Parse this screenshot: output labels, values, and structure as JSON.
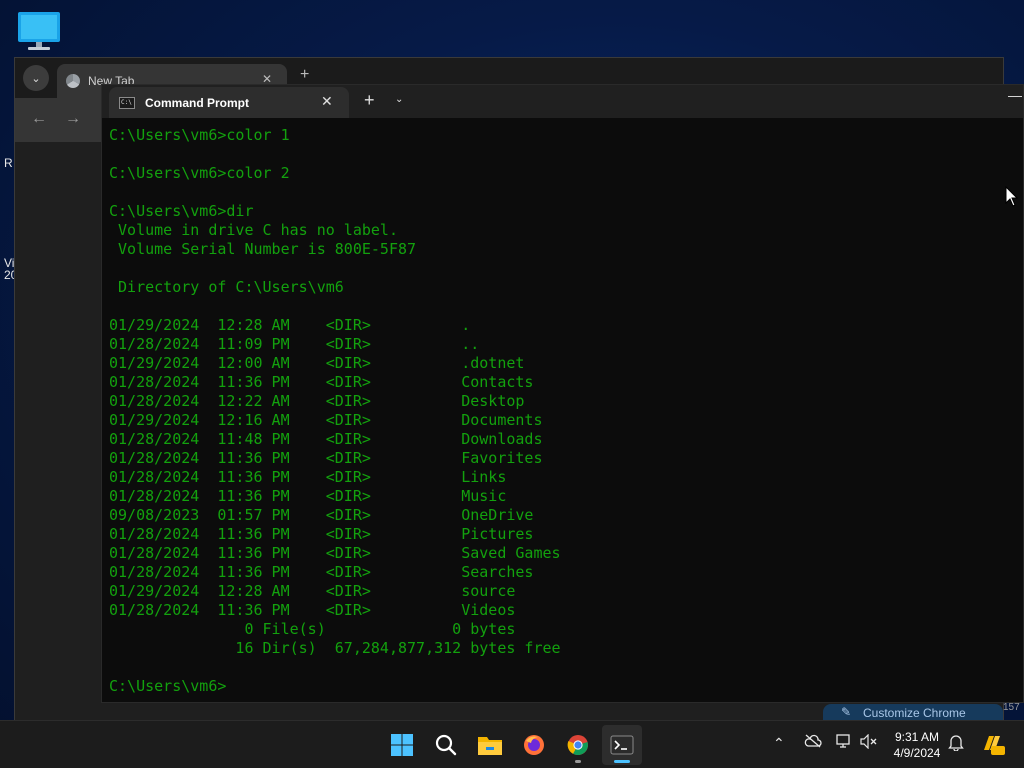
{
  "desktop": {
    "edge_text": [
      "R",
      "Vi",
      "20"
    ]
  },
  "chrome": {
    "tab_title": "New Tab",
    "customize_label": "Customize Chrome",
    "counter": "157"
  },
  "terminal": {
    "tab_title": "Command Prompt",
    "lines": [
      "C:\\Users\\vm6>color 1",
      "",
      "C:\\Users\\vm6>color 2",
      "",
      "C:\\Users\\vm6>dir",
      " Volume in drive C has no label.",
      " Volume Serial Number is 800E-5F87",
      "",
      " Directory of C:\\Users\\vm6",
      "",
      "01/29/2024  12:28 AM    <DIR>          .",
      "01/28/2024  11:09 PM    <DIR>          ..",
      "01/29/2024  12:00 AM    <DIR>          .dotnet",
      "01/28/2024  11:36 PM    <DIR>          Contacts",
      "01/28/2024  12:22 AM    <DIR>          Desktop",
      "01/29/2024  12:16 AM    <DIR>          Documents",
      "01/28/2024  11:48 PM    <DIR>          Downloads",
      "01/28/2024  11:36 PM    <DIR>          Favorites",
      "01/28/2024  11:36 PM    <DIR>          Links",
      "01/28/2024  11:36 PM    <DIR>          Music",
      "09/08/2023  01:57 PM    <DIR>          OneDrive",
      "01/28/2024  11:36 PM    <DIR>          Pictures",
      "01/28/2024  11:36 PM    <DIR>          Saved Games",
      "01/28/2024  11:36 PM    <DIR>          Searches",
      "01/29/2024  12:28 AM    <DIR>          source",
      "01/28/2024  11:36 PM    <DIR>          Videos",
      "               0 File(s)              0 bytes",
      "              16 Dir(s)  67,284,877,312 bytes free",
      "",
      "C:\\Users\\vm6>"
    ]
  },
  "taskbar": {
    "time": "9:31 AM",
    "date": "4/9/2024",
    "apps": [
      "start",
      "search",
      "file-explorer",
      "firefox",
      "chrome",
      "terminal"
    ],
    "colors": {
      "accent": "#4cc2ff",
      "terminal_text": "#13a10e"
    }
  }
}
